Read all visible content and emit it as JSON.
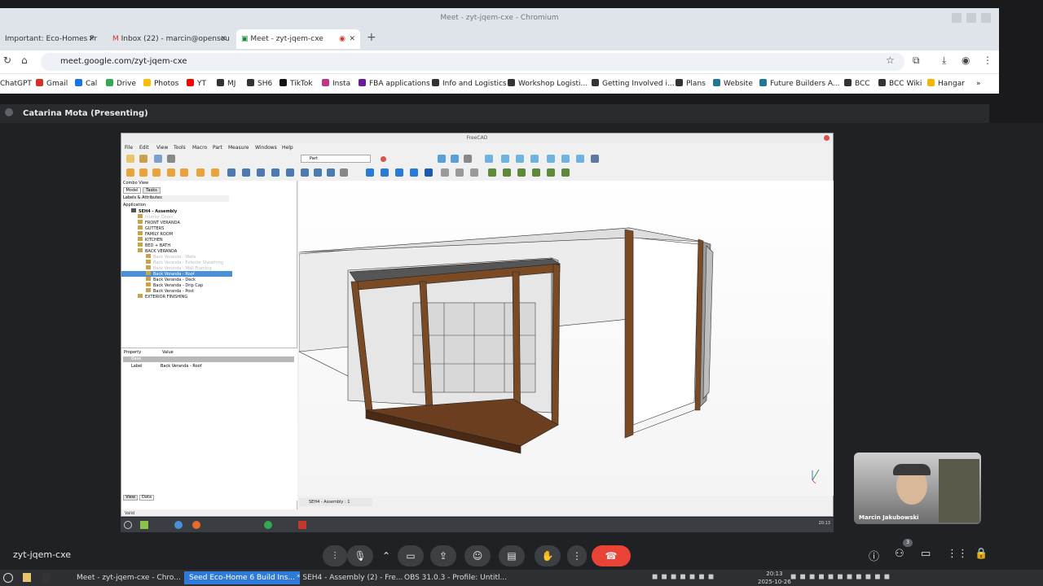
{
  "window": {
    "title": "Meet - zyt-jqem-cxe - Chromium"
  },
  "tabs": [
    {
      "label": "Important: Eco-Homes Pr"
    },
    {
      "label": "Inbox (22) - marcin@opensou"
    },
    {
      "label": "Meet - zyt-jqem-cxe"
    }
  ],
  "url": "meet.google.com/zyt-jqem-cxe",
  "bookmarks": [
    "ChatGPT",
    "Gmail",
    "Cal",
    "Drive",
    "Photos",
    "YT",
    "MJ",
    "SH6",
    "TikTok",
    "Insta",
    "FBA applications",
    "Info and Logistics",
    "Workshop Logisti...",
    "Getting Involved i...",
    "Plans",
    "Website",
    "Future Builders A...",
    "BCC",
    "BCC Wiki",
    "Hangar"
  ],
  "meet": {
    "presenter": "Catarina Mota (Presenting)",
    "code": "zyt-jqem-cxe",
    "participant": "Marcin Jakubowski",
    "participant_count": "3"
  },
  "freecad": {
    "title": "FreeCAD",
    "menu": [
      "File",
      "Edit",
      "View",
      "Tools",
      "Macro",
      "Part",
      "Measure",
      "Windows",
      "Help"
    ],
    "workbench": "Part",
    "combo_title": "Combo View",
    "combo_tabs": [
      "Model",
      "Tasks"
    ],
    "labels_header": "Labels & Attributes",
    "app_label": "Application",
    "tree": [
      {
        "label": "SEH4 - Assembly",
        "indent": 1,
        "bold": true
      },
      {
        "label": "Interior Doors",
        "indent": 2,
        "dim": true
      },
      {
        "label": "FRONT VERANDA",
        "indent": 2
      },
      {
        "label": "GUTTERS",
        "indent": 2
      },
      {
        "label": "FAMILY ROOM",
        "indent": 2
      },
      {
        "label": "KITCHEN",
        "indent": 2
      },
      {
        "label": "BED + BATH",
        "indent": 2
      },
      {
        "label": "BACK VERANDA",
        "indent": 2
      },
      {
        "label": "Back Veranda - Walls",
        "indent": 3,
        "dim": true
      },
      {
        "label": "Back Veranda - Exterior Sheathing",
        "indent": 3,
        "dim": true
      },
      {
        "label": "Back Veranda - Wall Framing",
        "indent": 3,
        "dim": true
      },
      {
        "label": "Back Veranda - Roof",
        "indent": 3,
        "selected": true
      },
      {
        "label": "Back Veranda - Deck",
        "indent": 3
      },
      {
        "label": "Back Veranda - Drip Cap",
        "indent": 3
      },
      {
        "label": "Back Veranda - Post",
        "indent": 3
      },
      {
        "label": "EXTERIOR FINISHING",
        "indent": 2
      }
    ],
    "prop_headers": [
      "Property",
      "Value"
    ],
    "prop_group": "Base",
    "prop_rows": [
      {
        "k": "Label",
        "v": "Back Veranda - Roof"
      }
    ],
    "bottom_tabs": [
      "View",
      "Data"
    ],
    "view_tab": "SEH4 - Assembly : 1",
    "status": "Valid",
    "clock": "20:13"
  },
  "taskbar": {
    "items": [
      "Meet - zyt-jqem-cxe - Chro...",
      "Seed Eco-Home 6 Build Ins...",
      "* SEH4 - Assembly (2) - Fre...",
      "OBS 31.0.3 - Profile: Untitl..."
    ],
    "time": "20:13",
    "date": "2025-10-26"
  }
}
